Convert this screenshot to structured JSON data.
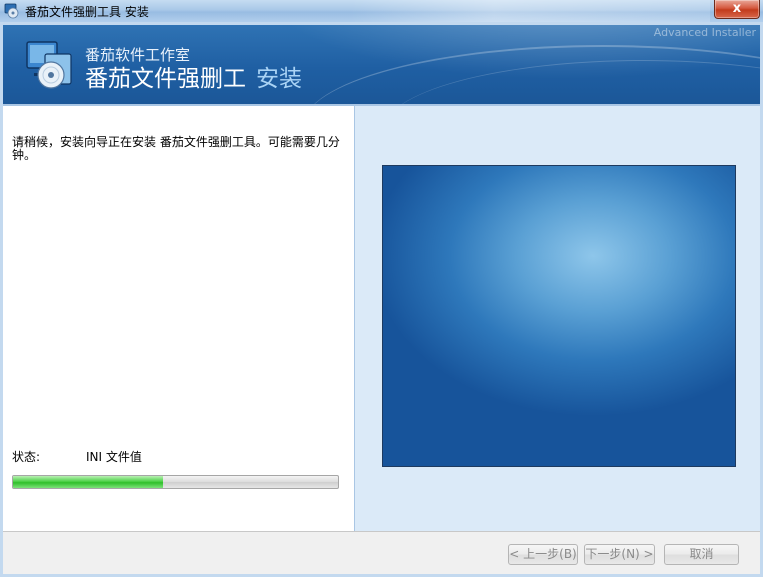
{
  "window": {
    "title": "番茄文件强删工具 安装",
    "close_label": "x"
  },
  "banner": {
    "subtitle": "番茄软件工作室",
    "title": "番茄文件强删工",
    "title_suffix": "安装",
    "brand": "Advanced Installer"
  },
  "main": {
    "wait_text": "请稍候，安装向导正在安装 番茄文件强删工具。可能需要几分钟。",
    "status_label": "状态:",
    "status_value": "INI 文件值",
    "progress_percent": 46
  },
  "buttons": {
    "back": "< 上一步(B)",
    "next": "下一步(N) >",
    "cancel": "取消"
  },
  "colors": {
    "banner": "#1f5fa3",
    "progress": "#2fbf2a",
    "right_pane": "#dbeaf8"
  },
  "icons": {
    "app": "installer-cd-icon",
    "banner": "installer-cd-icon",
    "close": "close-icon"
  }
}
